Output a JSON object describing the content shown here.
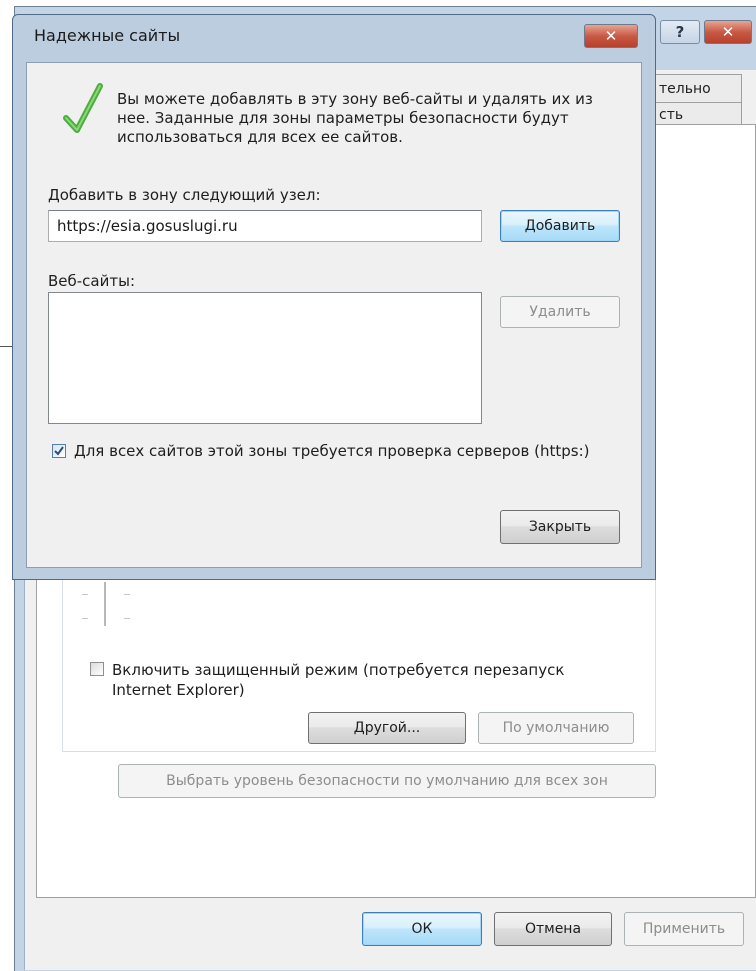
{
  "background_window": {
    "tabs": [
      "тельно",
      "сть"
    ],
    "protected_mode_label": "Включить защищенный режим (потребуется перезапуск",
    "protected_mode_label_2": "Internet Explorer)",
    "custom_button": "Другой...",
    "default_button": "По умолчанию",
    "reset_all_zones_button": "Выбрать уровень безопасности по умолчанию для всех зон",
    "ok_button": "ОК",
    "cancel_button": "Отмена",
    "apply_button": "Применить",
    "help_icon_glyph": "?",
    "close_icon_glyph": "✕"
  },
  "dialog": {
    "title": "Надежные сайты",
    "close_icon_glyph": "✕",
    "description": "Вы можете добавлять в эту зону  веб-сайты и удалять их из нее. Заданные для зоны параметры безопасности будут использоваться для всех ее сайтов.",
    "add_label": "Добавить в зону следующий узел:",
    "add_input_value": "https://esia.gosuslugi.ru",
    "add_button": "Добавить",
    "websites_label": "Веб-сайты:",
    "websites": [],
    "remove_button": "Удалить",
    "require_https_label": "Для всех сайтов этой зоны требуется проверка серверов (https:)",
    "require_https_checked": true,
    "close_button": "Закрыть"
  },
  "colors": {
    "close_red": "#c4473a",
    "check_green": "#4cae3b",
    "default_button_blue": "#3c7fb1"
  },
  "icons": [
    "check-icon",
    "close-icon",
    "help-icon",
    "checkbox-icon"
  ]
}
